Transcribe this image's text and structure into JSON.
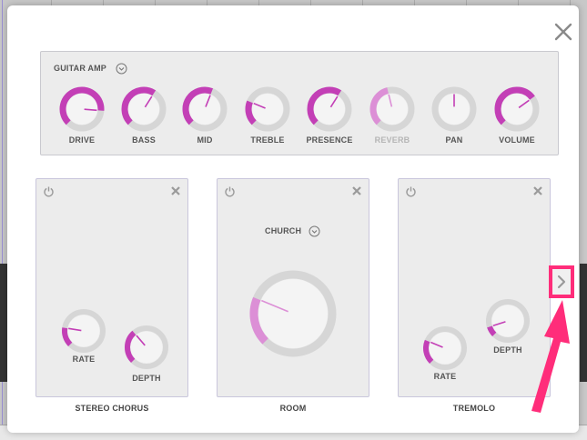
{
  "amp": {
    "title": "GUITAR AMP",
    "knobs": [
      {
        "label": "DRIVE",
        "value": 0.85,
        "disabled": false
      },
      {
        "label": "BASS",
        "value": 0.62,
        "disabled": false
      },
      {
        "label": "MID",
        "value": 0.58,
        "disabled": false
      },
      {
        "label": "TREBLE",
        "value": 0.25,
        "disabled": false
      },
      {
        "label": "PRESENCE",
        "value": 0.62,
        "disabled": false
      },
      {
        "label": "REVERB",
        "value": 0.45,
        "disabled": true
      },
      {
        "label": "PAN",
        "value": 0.5,
        "disabled": false
      },
      {
        "label": "VOLUME",
        "value": 0.7,
        "disabled": false
      }
    ]
  },
  "effects": [
    {
      "name": "STEREO CHORUS",
      "knobs": [
        {
          "label": "RATE",
          "value": 0.2
        },
        {
          "label": "DEPTH",
          "value": 0.35
        }
      ]
    },
    {
      "name": "ROOM",
      "preset": "CHURCH",
      "knobs": [
        {
          "label": "",
          "value": 0.25
        }
      ]
    },
    {
      "name": "TREMOLO",
      "knobs": [
        {
          "label": "RATE",
          "value": 0.25
        },
        {
          "label": "DEPTH",
          "value": 0.1
        }
      ]
    }
  ],
  "colors": {
    "accent": "#c33fb6",
    "accent_light": "#dc8fd6",
    "track": "#d6d6d6",
    "highlight": "#ff2d7a"
  },
  "icons": {
    "close": "close-icon",
    "power": "power-icon",
    "remove": "remove-icon",
    "next": "chevron-right-icon",
    "dropdown": "chevron-down-circle-icon"
  }
}
